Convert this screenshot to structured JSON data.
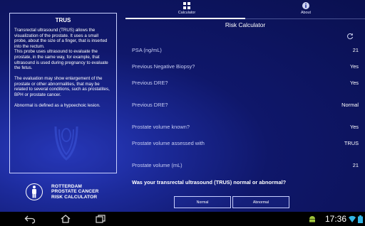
{
  "info_panel": {
    "title": "TRUS",
    "paragraphs": [
      "Transrectal ultrasound (TRUS) allows the visualization of the prostate. It uses a small probe, about the size of a finger, that is inserted into the rectum.\nThis probe uses ultrasound to evaluate the prostate, in the same way, for example, that ultrasound is used during pregnancy to evaluate the fetus.",
      "The evaluation may show enlargement of the prostate or other abnormalities, that may be related to several conditions, such as prostatites, BPH or prostate cancer.",
      "Abnormal is defined as a hypoechoic lesion."
    ]
  },
  "logo": {
    "line1": "ROTTERDAM",
    "line2": "PROSTATE CANCER",
    "line3": "RISK CALCULATOR"
  },
  "tabs": [
    {
      "label": "Calculator",
      "icon": "grid-icon",
      "selected": true
    },
    {
      "label": "About",
      "icon": "info-icon",
      "selected": false
    }
  ],
  "calculator": {
    "title": "Risk Calculator",
    "refresh_icon": "refresh-icon",
    "rows": [
      {
        "label": "PSA (ng/mL)",
        "value": "21"
      },
      {
        "label": "Previous Negative Biopsy?",
        "value": "Yes"
      },
      {
        "label": "Previous DRE?",
        "value": "Yes"
      },
      {
        "label": "Previous DRE?",
        "value": "Normal"
      },
      {
        "label": "Prostate volume known?",
        "value": "Yes"
      },
      {
        "label": "Prostate volume assessed with",
        "value": "TRUS"
      },
      {
        "label": "Prostate volume (mL)",
        "value": "21"
      }
    ],
    "question": "Was your transrectal ultrasound (TRUS) normal or abnormal?",
    "options": [
      "Normal",
      "Abnormal"
    ]
  },
  "status_bar": {
    "time": "17:36",
    "nav_icons": [
      "back-icon",
      "home-icon",
      "recents-icon"
    ],
    "status_icons": [
      "android-icon",
      "wifi-icon",
      "battery-icon"
    ]
  },
  "colors": {
    "background": "#1c2a9a",
    "accent": "#ffffff",
    "label_text": "#c7cdf4"
  }
}
